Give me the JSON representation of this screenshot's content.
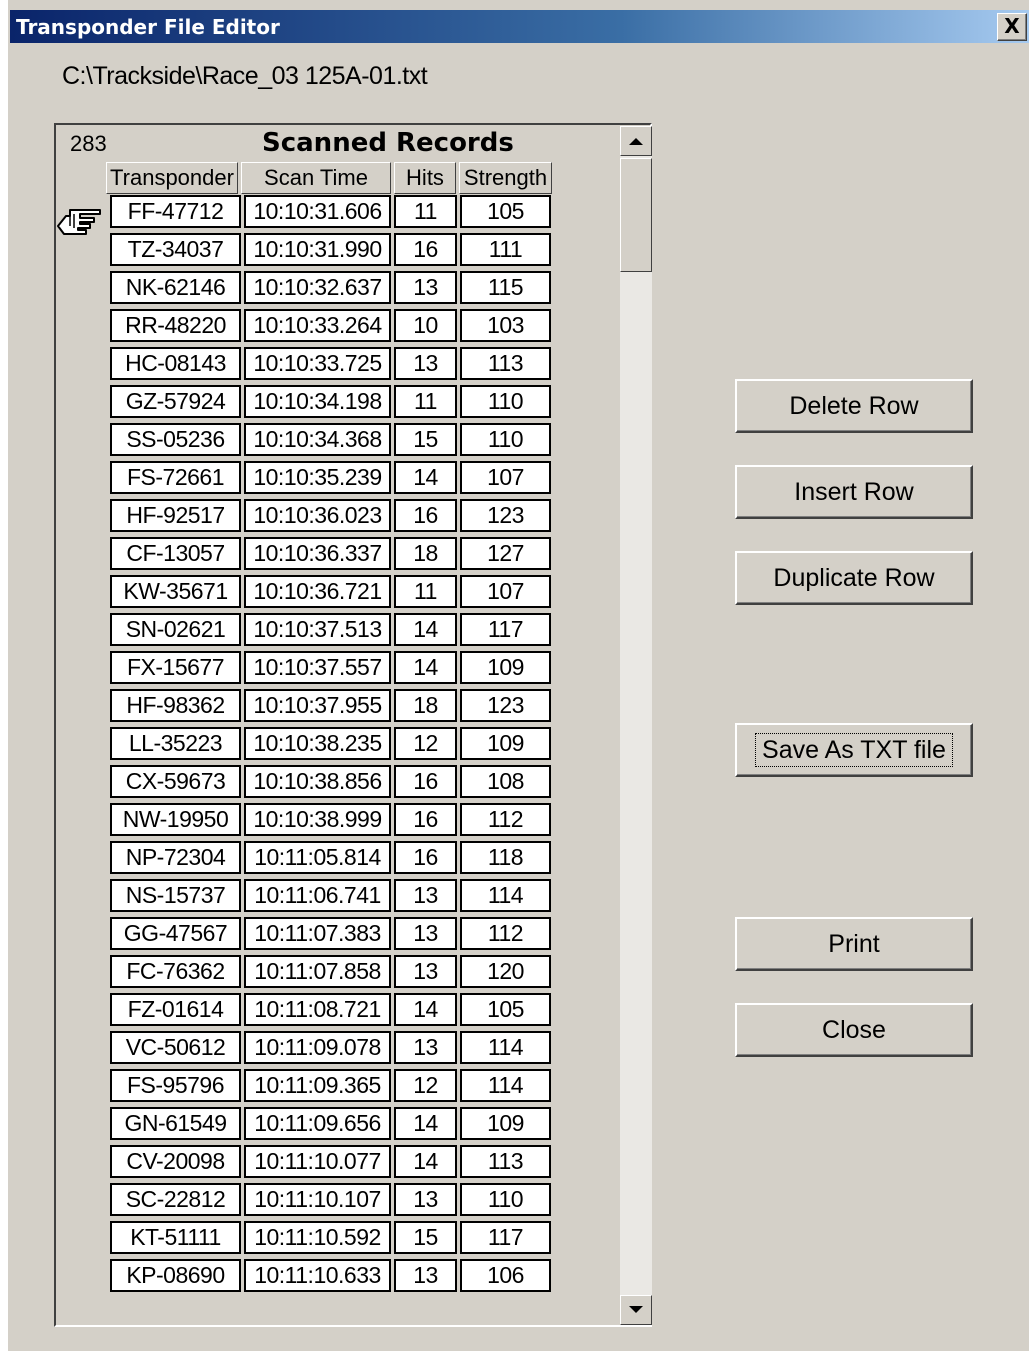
{
  "window": {
    "title": "Transponder File Editor",
    "close_label": "X"
  },
  "file_path": "C:\\Trackside\\Race_03 125A-01.txt",
  "panel": {
    "record_count": "283",
    "title": "Scanned Records"
  },
  "table": {
    "columns": [
      "Transponder",
      "Scan Time",
      "Hits",
      "Strength"
    ],
    "rows": [
      [
        "FF-47712",
        "10:10:31.606",
        "11",
        "105"
      ],
      [
        "TZ-34037",
        "10:10:31.990",
        "16",
        "111"
      ],
      [
        "NK-62146",
        "10:10:32.637",
        "13",
        "115"
      ],
      [
        "RR-48220",
        "10:10:33.264",
        "10",
        "103"
      ],
      [
        "HC-08143",
        "10:10:33.725",
        "13",
        "113"
      ],
      [
        "GZ-57924",
        "10:10:34.198",
        "11",
        "110"
      ],
      [
        "SS-05236",
        "10:10:34.368",
        "15",
        "110"
      ],
      [
        "FS-72661",
        "10:10:35.239",
        "14",
        "107"
      ],
      [
        "HF-92517",
        "10:10:36.023",
        "16",
        "123"
      ],
      [
        "CF-13057",
        "10:10:36.337",
        "18",
        "127"
      ],
      [
        "KW-35671",
        "10:10:36.721",
        "11",
        "107"
      ],
      [
        "SN-02621",
        "10:10:37.513",
        "14",
        "117"
      ],
      [
        "FX-15677",
        "10:10:37.557",
        "14",
        "109"
      ],
      [
        "HF-98362",
        "10:10:37.955",
        "18",
        "123"
      ],
      [
        "LL-35223",
        "10:10:38.235",
        "12",
        "109"
      ],
      [
        "CX-59673",
        "10:10:38.856",
        "16",
        "108"
      ],
      [
        "NW-19950",
        "10:10:38.999",
        "16",
        "112"
      ],
      [
        "NP-72304",
        "10:11:05.814",
        "16",
        "118"
      ],
      [
        "NS-15737",
        "10:11:06.741",
        "13",
        "114"
      ],
      [
        "GG-47567",
        "10:11:07.383",
        "13",
        "112"
      ],
      [
        "FC-76362",
        "10:11:07.858",
        "13",
        "120"
      ],
      [
        "FZ-01614",
        "10:11:08.721",
        "14",
        "105"
      ],
      [
        "VC-50612",
        "10:11:09.078",
        "13",
        "114"
      ],
      [
        "FS-95796",
        "10:11:09.365",
        "12",
        "114"
      ],
      [
        "GN-61549",
        "10:11:09.656",
        "14",
        "109"
      ],
      [
        "CV-20098",
        "10:11:10.077",
        "14",
        "113"
      ],
      [
        "SC-22812",
        "10:11:10.107",
        "13",
        "110"
      ],
      [
        "KT-51111",
        "10:11:10.592",
        "15",
        "117"
      ],
      [
        "KP-08690",
        "10:11:10.633",
        "13",
        "106"
      ]
    ]
  },
  "buttons": {
    "delete_row": "Delete Row",
    "insert_row": "Insert Row",
    "duplicate_row": "Duplicate Row",
    "save_txt": "Save As TXT file",
    "print": "Print",
    "close": "Close"
  },
  "icons": {
    "row_pointer": "pointing-hand-icon",
    "scroll_up": "arrow-up-icon",
    "scroll_down": "arrow-down-icon"
  }
}
